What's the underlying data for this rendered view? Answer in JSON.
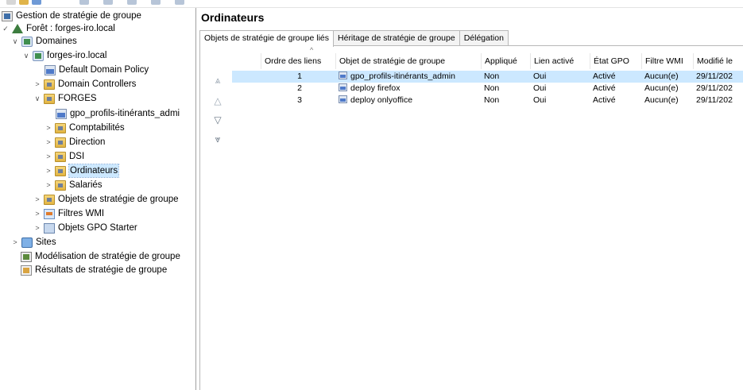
{
  "tree": {
    "items": [
      {
        "label": "Gestion de stratégie de groupe",
        "icon": "gpmc-root-icon",
        "toggle": ""
      },
      {
        "label": "Forêt : forges-iro.local",
        "icon": "forest-icon",
        "toggle": "✓"
      },
      {
        "label": "Domaines",
        "icon": "domains-icon",
        "toggle": "∨"
      },
      {
        "label": "forges-iro.local",
        "icon": "domain-icon",
        "toggle": "∨"
      },
      {
        "label": "Default Domain Policy",
        "icon": "gpo-link-icon",
        "toggle": ""
      },
      {
        "label": "Domain Controllers",
        "icon": "ou-folder-icon",
        "toggle": ">"
      },
      {
        "label": "FORGES",
        "icon": "ou-folder-icon",
        "toggle": "∨"
      },
      {
        "label": "gpo_profils-itinérants_admi",
        "icon": "gpo-link-icon",
        "toggle": ""
      },
      {
        "label": "Comptabilités",
        "icon": "ou-folder-icon",
        "toggle": ">"
      },
      {
        "label": "Direction",
        "icon": "ou-folder-icon",
        "toggle": ">"
      },
      {
        "label": "DSI",
        "icon": "ou-folder-icon",
        "toggle": ">"
      },
      {
        "label": "Ordinateurs",
        "icon": "ou-folder-icon",
        "toggle": ">"
      },
      {
        "label": "Salariés",
        "icon": "ou-folder-icon",
        "toggle": ">"
      },
      {
        "label": "Objets de stratégie de groupe",
        "icon": "gpo-container-icon",
        "toggle": ">"
      },
      {
        "label": "Filtres WMI",
        "icon": "wmi-filter-icon",
        "toggle": ">"
      },
      {
        "label": "Objets GPO Starter",
        "icon": "starter-gpo-icon",
        "toggle": ">"
      },
      {
        "label": "Sites",
        "icon": "sites-icon",
        "toggle": ">"
      },
      {
        "label": "Modélisation de stratégie de groupe",
        "icon": "modeling-icon",
        "toggle": ""
      },
      {
        "label": "Résultats de stratégie de groupe",
        "icon": "results-icon",
        "toggle": ""
      }
    ]
  },
  "right": {
    "title": "Ordinateurs",
    "tabs": [
      {
        "label": "Objets de stratégie de groupe liés"
      },
      {
        "label": "Héritage de stratégie de groupe"
      },
      {
        "label": "Délégation"
      }
    ],
    "side_buttons": {
      "move_top": "⩓",
      "move_up": "△",
      "move_down": "▽",
      "move_bottom": "⩔"
    },
    "table": {
      "sort_indicator": "^",
      "headers": [
        "Ordre des liens",
        "Objet de stratégie de groupe",
        "Appliqué",
        "Lien activé",
        "État GPO",
        "Filtre WMI",
        "Modifié le"
      ],
      "rows": [
        {
          "order": "1",
          "gpo": "gpo_profils-itinérants_admin",
          "enforced": "Non",
          "enabled": "Oui",
          "status": "Activé",
          "wmi": "Aucun(e)",
          "modified": "29/11/202"
        },
        {
          "order": "2",
          "gpo": "deploy firefox",
          "enforced": "Non",
          "enabled": "Oui",
          "status": "Activé",
          "wmi": "Aucun(e)",
          "modified": "29/11/202"
        },
        {
          "order": "3",
          "gpo": "deploy onlyoffice",
          "enforced": "Non",
          "enabled": "Oui",
          "status": "Activé",
          "wmi": "Aucun(e)",
          "modified": "29/11/202"
        }
      ]
    }
  },
  "colors": {
    "selection": "#cce8ff",
    "tab_border": "#b8b8b8"
  }
}
